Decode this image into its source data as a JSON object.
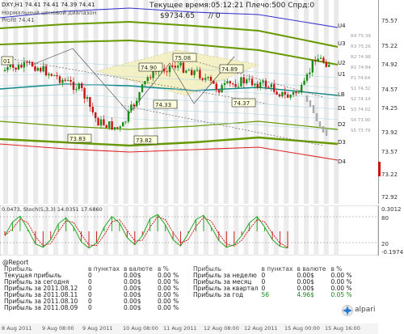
{
  "header": {
    "symbol_line": "DXY,H1  74.41 74.41 74.39 74.41",
    "indicator_line_1": "Нормальный ценовой диапазон",
    "indicator_line_2": "Profit 74.41",
    "current_time_label": "Текущее время:05:12:21 Плечо:500 Спрд:0",
    "balance": "$9734.65",
    "balance_suffix": "// 0"
  },
  "main_scale_labels": [
    "75.57",
    "75.22",
    "74.92",
    "74.57",
    "74.25",
    "73.92",
    "73.57",
    "73.22",
    "72.92"
  ],
  "level_labels": [
    "U4",
    "U3",
    "U2",
    "U1",
    "LB",
    "D1",
    "D2",
    "D3",
    "D4"
  ],
  "band_value_labels": [
    "R4 75.39",
    "R3 75.26",
    "R2 74.98",
    "R1 74.84",
    "P1 74.64",
    "S1 74.32",
    "S2 74.14",
    "S3 74.02",
    "S4 73.90",
    "S5 73.79"
  ],
  "price_callouts": [
    "01",
    "74.90",
    "75.08",
    "74.89",
    "74.33",
    "74.37",
    "73.83",
    "73.82"
  ],
  "oscillator": {
    "label": "0.0473, Stoch(5,3,3) 14.0351 17.6860",
    "scale_labels": [
      "0.3012",
      "80",
      "20",
      "-0.1974"
    ],
    "stoch_values": [
      40,
      72,
      86,
      55,
      20,
      12,
      30,
      68,
      82,
      60,
      25,
      10,
      22,
      60,
      85,
      70,
      35,
      18,
      40,
      80,
      90,
      65,
      30,
      15,
      45,
      78,
      88,
      60,
      28,
      12,
      18,
      40,
      70,
      85,
      60,
      30,
      14,
      10
    ]
  },
  "report": {
    "title": "@Report",
    "headers": [
      "в пунктах",
      "в валюте",
      "в %"
    ],
    "left_rows": [
      {
        "label": "Прибыль",
        "points": "в пунктах",
        "currency": "в валюте",
        "pct": "в %"
      },
      {
        "label": "Текущая прибыль",
        "points": "0",
        "currency": "0.00$",
        "pct": "0.00 %"
      },
      {
        "label": "Прибыль за сегодня",
        "points": "0",
        "currency": "0.00$",
        "pct": "0.00 %"
      },
      {
        "label": "Прибыль за 2011.08.12",
        "points": "0",
        "currency": "0.00$",
        "pct": "0.00 %"
      },
      {
        "label": "Прибыль за 2011.08.11",
        "points": "0",
        "currency": "0.00$",
        "pct": "0.00 %"
      },
      {
        "label": "Прибыль за 2011.08.10",
        "points": "0",
        "currency": "0.00$",
        "pct": "0.00 %"
      },
      {
        "label": "Прибыль за 2011.08.09",
        "points": "0",
        "currency": "0.00$",
        "pct": "0.00 %"
      }
    ],
    "right_rows": [
      {
        "label": "Прибыль",
        "points": "в пунктах",
        "currency": "в валюте",
        "pct": "в %"
      },
      {
        "label": "Прибыль за неделю",
        "points": "0",
        "currency": "0.00$",
        "pct": "0.00 %"
      },
      {
        "label": "Прибыль за месяц",
        "points": "0",
        "currency": "0.00$",
        "pct": "0.00 %"
      },
      {
        "label": "Прибыль за квартал",
        "points": "0",
        "currency": "0.00$",
        "pct": "0.00 %"
      },
      {
        "label": "Прибыль за год",
        "points": "56",
        "currency": "4.96$",
        "pct": "0.05 %"
      }
    ],
    "brand": "alpari"
  },
  "time_axis": [
    "8 Aug 2011",
    "9 Aug 08:00",
    "9 Aug 2011",
    "10 Aug 08:00",
    "11 Aug 2011",
    "12 Aug 08:00",
    "12 Aug 2011",
    "15 Aug 00:00",
    "15 Aug 16:00"
  ],
  "colors": {
    "bull_candle": "#1a8a1a",
    "bear_candle": "#cc1111",
    "band_green": "#669900",
    "band_blue": "#3333cc",
    "band_red": "#dd2222",
    "zone_fill": "#f3f0c0",
    "stoch_line": "#22aa22",
    "signal_line": "#cc2222"
  }
}
